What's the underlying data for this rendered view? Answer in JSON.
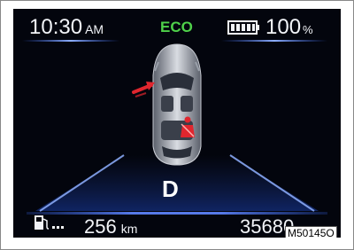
{
  "status_bar": {
    "time": "10:30",
    "time_period": "AM",
    "drive_mode": "ECO",
    "battery_level": "100",
    "battery_unit": "%"
  },
  "vehicle": {
    "gear": "D",
    "warning_icon": "seatbelt-warning-icon",
    "door_indicator_icon": "open-door-arrow-icon"
  },
  "trip": {
    "range_value": "256",
    "range_unit": "km",
    "odometer": "35680"
  },
  "figure_code": "M50145O",
  "colors": {
    "background": "#03050d",
    "eco": "#4fd14a",
    "accent_blue": "#3a6cff",
    "warning_red": "#e0262e"
  }
}
